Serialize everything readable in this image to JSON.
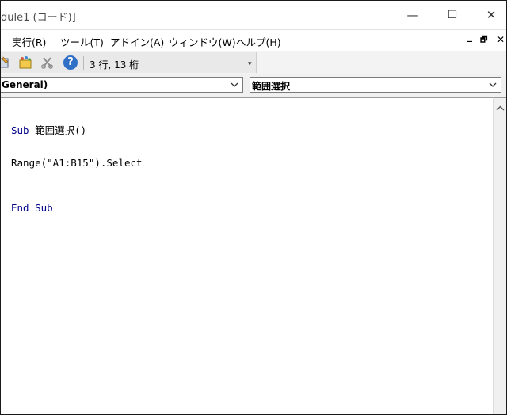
{
  "window": {
    "title": "dule1 (コード)]",
    "controls": {
      "minimize": "—",
      "maximize": "☐",
      "close": "✕"
    }
  },
  "menu": {
    "items": [
      "実行(R)",
      "ツール(T)",
      "アドイン(A)",
      "ウィンドウ(W)",
      "ヘルプ(H)"
    ],
    "mdi_minimize": "_",
    "mdi_restore": "🗗",
    "mdi_close": "✕"
  },
  "toolbar": {
    "help_glyph": "?",
    "cursor_position": "3 行, 13 桁",
    "overflow_glyph": "▾"
  },
  "combos": {
    "object": "General)",
    "procedure": "範囲選択"
  },
  "code": {
    "line1_keyword": "Sub",
    "line1_rest": " 範囲選択()",
    "line2": "Range(\"A1:B15\").Select",
    "line3_keyword": "End Sub"
  },
  "icons": {
    "toolbar": [
      "design-mode-icon",
      "userform-icon",
      "cut-icon",
      "help-icon"
    ],
    "dropdown": "chevron-down-icon",
    "scroll": "arrow-up-icon"
  }
}
